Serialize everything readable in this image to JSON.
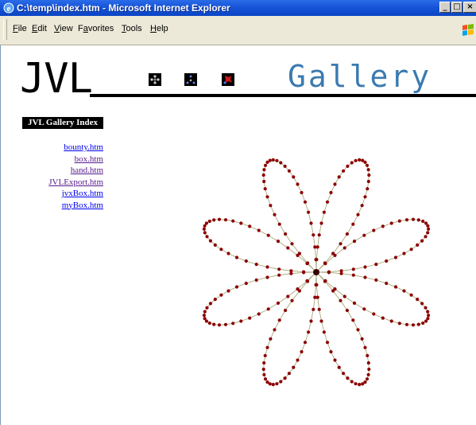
{
  "window": {
    "title": "C:\\temp\\index.htm - Microsoft Internet Explorer",
    "buttons": [
      "_",
      "□",
      "×"
    ]
  },
  "menu": {
    "items": [
      {
        "label": "File",
        "accel": "F"
      },
      {
        "label": "Edit",
        "accel": "E"
      },
      {
        "label": "View",
        "accel": "V"
      },
      {
        "label": "Favorites",
        "accel": "a"
      },
      {
        "label": "Tools",
        "accel": "T"
      },
      {
        "label": "Help",
        "accel": "H"
      }
    ]
  },
  "page": {
    "logo_text": "JVL",
    "heading": "Gallery",
    "index_title": "JVL Gallery Index",
    "links": [
      {
        "label": "bounty.htm",
        "visited": false
      },
      {
        "label": "box.htm",
        "visited": true
      },
      {
        "label": "hand.htm",
        "visited": true
      },
      {
        "label": "JVLExport.htm",
        "visited": true
      },
      {
        "label": "jvxBox.htm",
        "visited": false
      },
      {
        "label": "myBox.htm",
        "visited": false
      }
    ],
    "flower": {
      "petals": 8,
      "point_color": "#8b0000",
      "edge_color": "#a0a070"
    }
  },
  "colors": {
    "titlebar": "#1754d8",
    "gallery_text": "#3b7ab0",
    "link": "#0000ee",
    "link_visited": "#551a8b"
  }
}
